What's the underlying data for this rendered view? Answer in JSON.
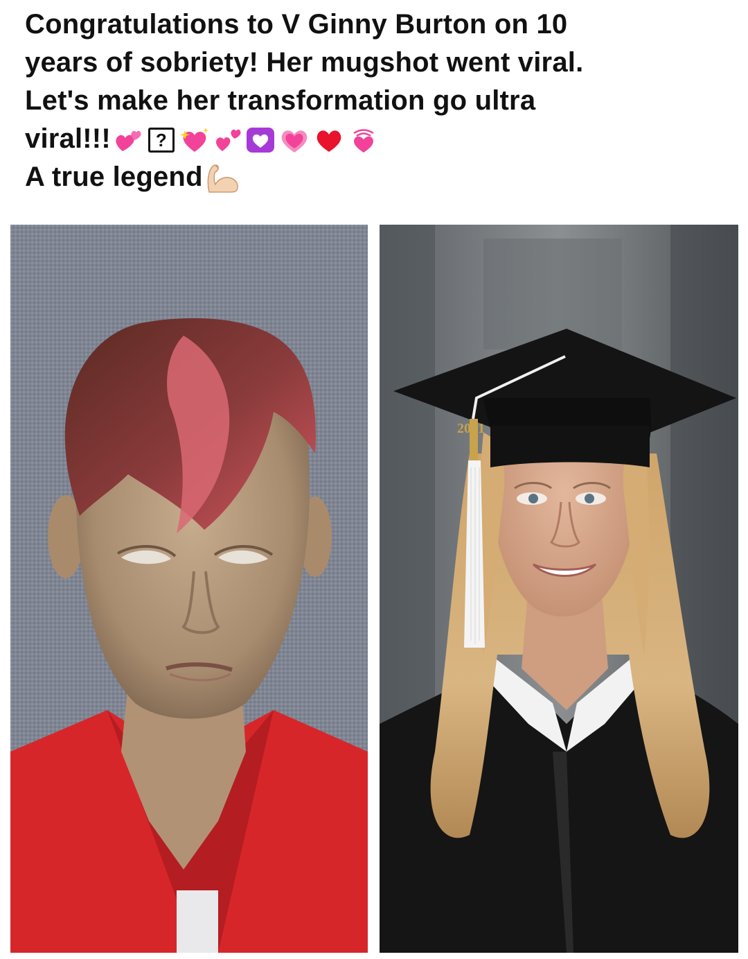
{
  "post": {
    "line1": "Congratulations to V Ginny Burton on 10",
    "line2": "years of sobriety! Her mugshot went viral.",
    "line3": "Let's make her transformation go ultra",
    "line4_text": "viral!!!",
    "missing_glyph": "?",
    "line5_text": "A true legend",
    "emojis_line4": [
      "revolving-hearts-icon",
      "missing-glyph-box",
      "sparkling-heart-icon",
      "two-hearts-icon",
      "heart-decoration-icon",
      "growing-heart-icon",
      "red-heart-icon",
      "beating-heart-icon"
    ],
    "emoji_line5": "flexed-biceps-icon"
  },
  "images": {
    "left": {
      "name": "mugshot-photo"
    },
    "right": {
      "name": "graduation-photo",
      "tassel_charm_text": "2021"
    }
  },
  "colors": {
    "text": "#111111",
    "heart_pink": "#f2429a",
    "heart_red": "#e8132c",
    "heart_purple": "#a63ad6",
    "mugshot_shirt": "#d7262a",
    "mugshot_bg": "#7f8592",
    "gown_black": "#151515"
  }
}
